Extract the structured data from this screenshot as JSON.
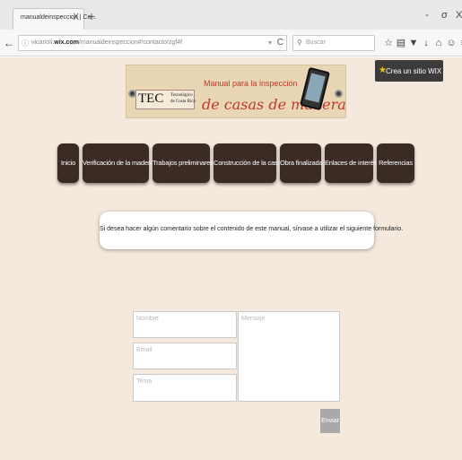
{
  "browser": {
    "tab_title": "manualdeinspeccion | Co...",
    "tab_close": "X",
    "new_tab": "+",
    "window_controls": [
      "-",
      "σ",
      "X"
    ],
    "back": "←",
    "url_prefix": "vicarioli.",
    "url_domain": "wix.com",
    "url_path": "/manualdeinspeccion#!contacto/zgf4f",
    "url_dropdown": "▾",
    "reload": "C",
    "search_placeholder": "Buscar",
    "toolbar_icons": [
      "☆",
      "▤",
      "▼",
      "↓",
      "⌂",
      "☺",
      "≡"
    ]
  },
  "banner": {
    "tec_logo": "TEC",
    "tec_sub": "Tecnológico de Costa Rica",
    "subtitle": "Manual para la inspección",
    "title": "de casas de madera"
  },
  "wix_badge": {
    "icon": "★",
    "label": "Crea un sitio WIX"
  },
  "menu": {
    "items": [
      "Inicio",
      "Verificación de la madera",
      "Trabajos preliminares",
      "Construcción de la casa",
      "Obra finalizada",
      "Enlaces de interés",
      "Referencias"
    ]
  },
  "contact": {
    "message": "Si desea hacer algún comentario sobre el contenido de este manual, sírvase a utilizar el siguiente formulario.",
    "name_placeholder": "Nombre",
    "email_placeholder": "Email",
    "subject_placeholder": "Tema",
    "message_placeholder": "Mensaje",
    "send_label": "Enviar"
  },
  "colors": {
    "page_background": "#f5e8dc",
    "menu_button": "#3a2b24",
    "banner_title": "#c0392b",
    "send_button": "#a9a9a9"
  }
}
